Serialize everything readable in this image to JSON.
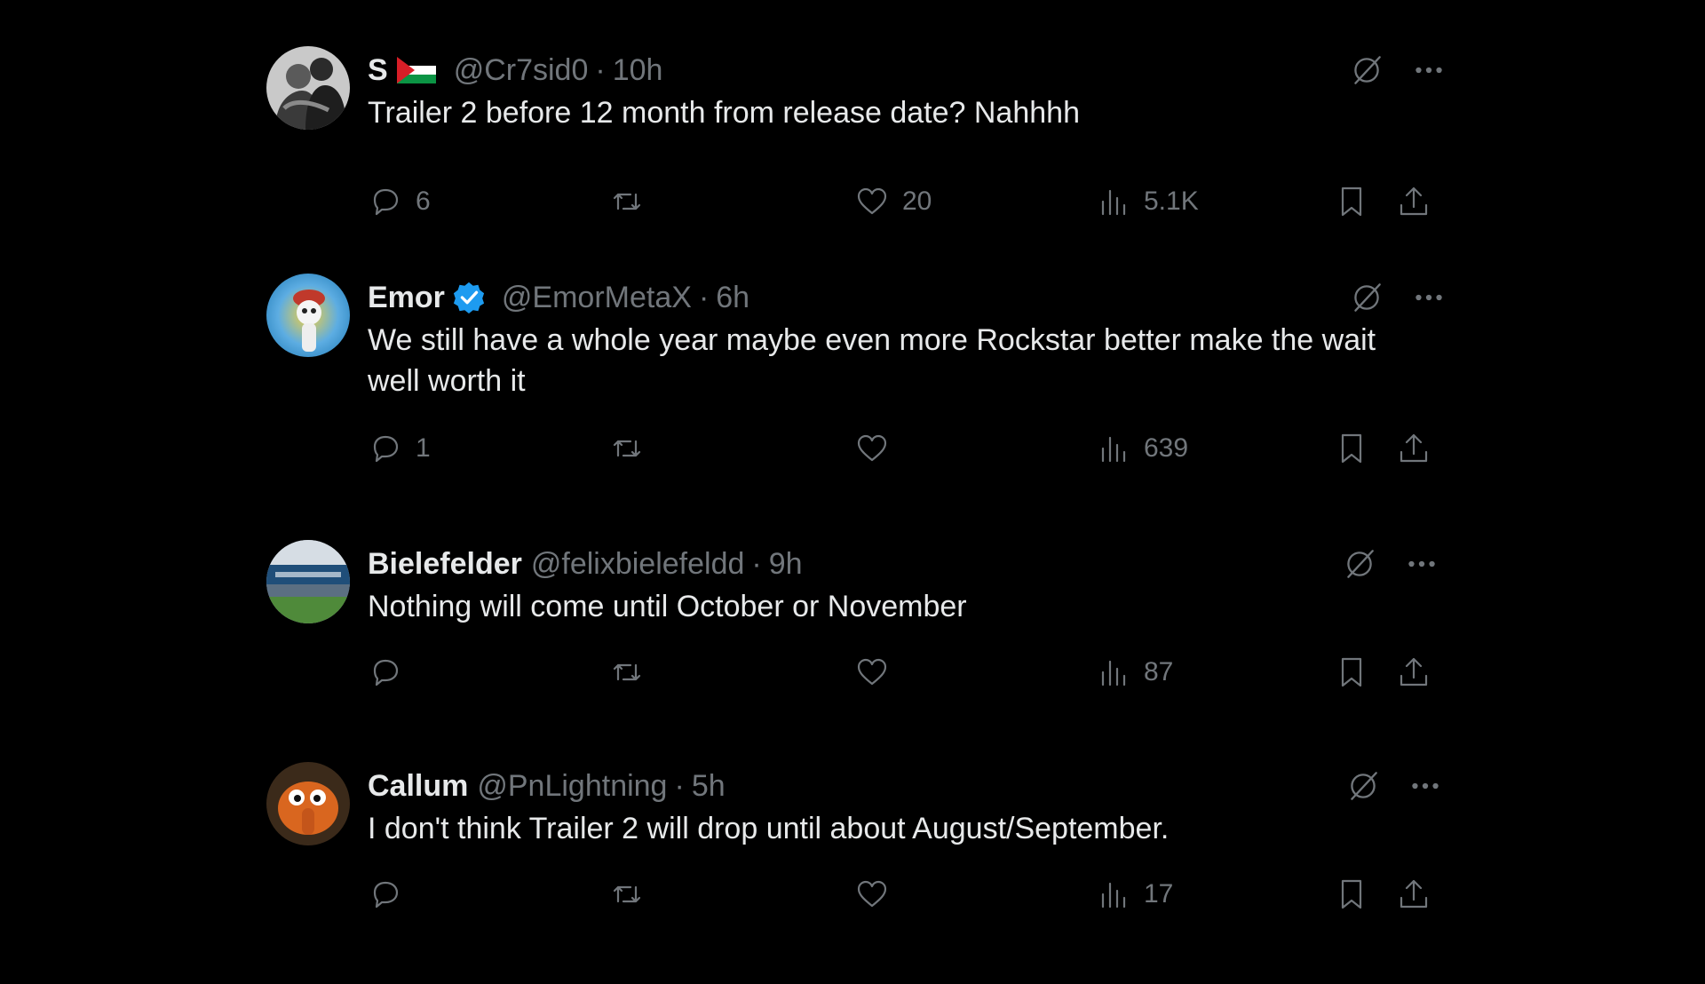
{
  "colors": {
    "background": "#000000",
    "primary_text": "#e7e9ea",
    "secondary_text": "#71767b",
    "verified_badge": "#1d9bf0"
  },
  "tweets": [
    {
      "name": "S",
      "has_flag": true,
      "flag": "palestine-flag",
      "verified": false,
      "handle": "@Cr7sid0",
      "separator": "·",
      "time": "10h",
      "text": "Trailer 2 before 12 month from release date? Nahhhh",
      "replies": "6",
      "retweets": "",
      "likes": "20",
      "views": "5.1K"
    },
    {
      "name": "Emor",
      "has_flag": false,
      "verified": true,
      "handle": "@EmorMetaX",
      "separator": "·",
      "time": "6h",
      "text": "We still have a whole year maybe even more Rockstar better make the wait well worth it",
      "replies": "1",
      "retweets": "",
      "likes": "",
      "views": "639"
    },
    {
      "name": "Bielefelder",
      "has_flag": false,
      "verified": false,
      "handle": "@felixbielefeldd",
      "separator": "·",
      "time": "9h",
      "text": "Nothing will come until October or November",
      "replies": "",
      "retweets": "",
      "likes": "",
      "views": "87"
    },
    {
      "name": "Callum",
      "has_flag": false,
      "verified": false,
      "handle": "@PnLightning",
      "separator": "·",
      "time": "5h",
      "text": "I don't think Trailer 2 will drop until about August/September.",
      "replies": "",
      "retweets": "",
      "likes": "",
      "views": "17"
    }
  ],
  "icons": {
    "reply": "reply-icon",
    "retweet": "retweet-icon",
    "like": "heart-icon",
    "views": "views-icon",
    "bookmark": "bookmark-icon",
    "share": "share-icon",
    "grok": "grok-icon",
    "more": "more-icon"
  }
}
